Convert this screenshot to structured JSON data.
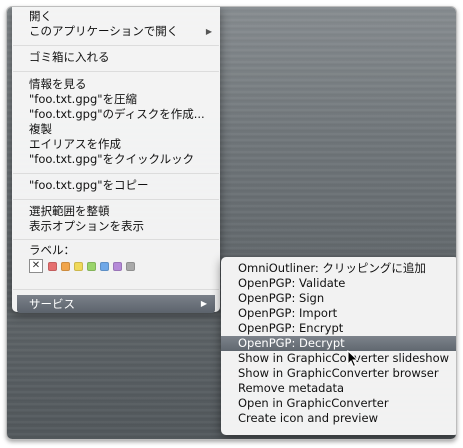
{
  "context_menu": {
    "groups": [
      {
        "items": [
          {
            "label": "開く"
          },
          {
            "label": "このアプリケーションで開く",
            "submenu": true
          }
        ]
      },
      {
        "items": [
          {
            "label": "ゴミ箱に入れる"
          }
        ]
      },
      {
        "items": [
          {
            "label": "情報を見る"
          },
          {
            "label": "\"foo.txt.gpg\"を圧縮"
          },
          {
            "label": "\"foo.txt.gpg\"のディスクを作成..."
          },
          {
            "label": "複製"
          },
          {
            "label": "エイリアスを作成"
          },
          {
            "label": "\"foo.txt.gpg\"をクイックルック"
          }
        ]
      },
      {
        "items": [
          {
            "label": "\"foo.txt.gpg\"をコピー"
          }
        ]
      },
      {
        "items": [
          {
            "label": "選択範囲を整頓"
          },
          {
            "label": "表示オプションを表示"
          }
        ]
      }
    ],
    "label_title": "ラベル：",
    "label_colors": [
      "#e56f6f",
      "#f1a54b",
      "#f0d95a",
      "#9ad46a",
      "#6fa8e8",
      "#b58ad8",
      "#a9a9a9"
    ],
    "services_label": "サービス"
  },
  "services_submenu": {
    "items": [
      {
        "label": "OmniOutliner: クリッピングに追加"
      },
      {
        "label": "OpenPGP: Validate"
      },
      {
        "label": "OpenPGP: Sign"
      },
      {
        "label": "OpenPGP: Import"
      },
      {
        "label": "OpenPGP: Encrypt"
      },
      {
        "label": "OpenPGP: Decrypt",
        "highlighted": true
      },
      {
        "label": "Show in GraphicConverter slideshow"
      },
      {
        "label": "Show in GraphicConverter browser"
      },
      {
        "label": "Remove metadata"
      },
      {
        "label": "Open in GraphicConverter"
      },
      {
        "label": "Create icon and preview"
      }
    ]
  },
  "icons": {
    "submenu_arrow": "▶",
    "label_none": "✕",
    "cursor": "arrow-pointer-icon"
  }
}
